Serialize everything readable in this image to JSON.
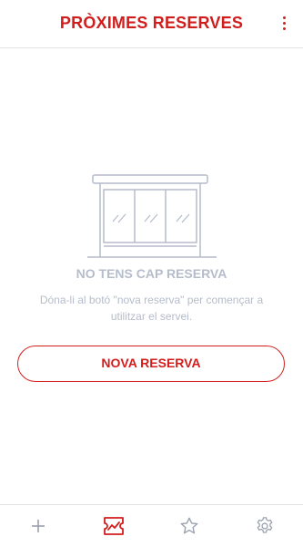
{
  "header": {
    "title": "PRÒXIMES RESERVES",
    "menu_icon": "more-vertical-icon"
  },
  "empty_state": {
    "illustration": "bus-stop-shelter-icon",
    "title": "NO TENS CAP RESERVA",
    "description": "Dóna-li al botó \"nova reserva\" per començar a utilitzar el servei."
  },
  "actions": {
    "new_booking_label": "NOVA RESERVA"
  },
  "bottom_nav": {
    "items": [
      {
        "icon": "plus-icon",
        "active": false
      },
      {
        "icon": "ticket-icon",
        "active": true
      },
      {
        "icon": "star-icon",
        "active": false
      },
      {
        "icon": "settings-icon",
        "active": false
      }
    ]
  },
  "colors": {
    "accent": "#d21d1d",
    "muted": "#b5bccb",
    "inactive_icon": "#9aa0ad",
    "divider": "#e4e4e4"
  }
}
